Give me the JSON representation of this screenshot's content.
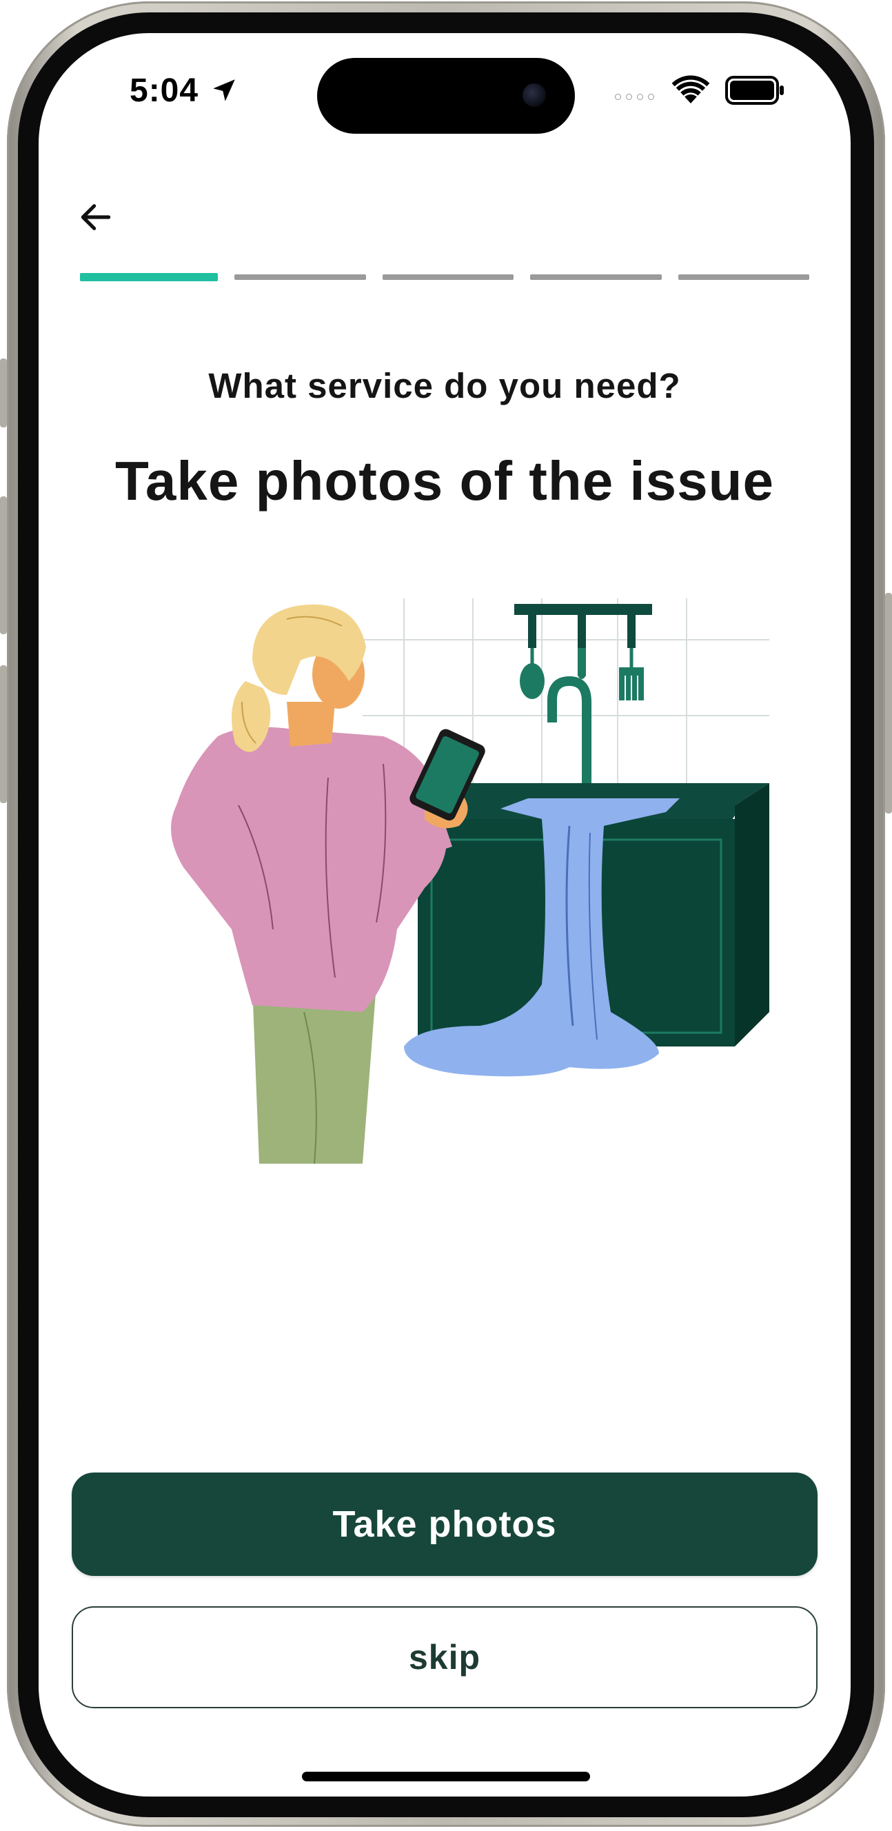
{
  "status_bar": {
    "time": "5:04",
    "icons": [
      "location-arrow-icon",
      "signal-dots-icon",
      "wifi-icon",
      "battery-icon"
    ]
  },
  "nav": {
    "back_icon": "arrow-left-icon",
    "progress": {
      "total_steps": 5,
      "current_step": 1,
      "active_color": "#1fbfa0",
      "inactive_color": "#9a9a9a"
    }
  },
  "content": {
    "subtitle": "What service do you need?",
    "title": "Take photos of the issue",
    "illustration": "woman-photographing-leaking-sink"
  },
  "actions": {
    "primary_label": "Take photos",
    "secondary_label": "skip",
    "primary_color": "#17473a"
  }
}
